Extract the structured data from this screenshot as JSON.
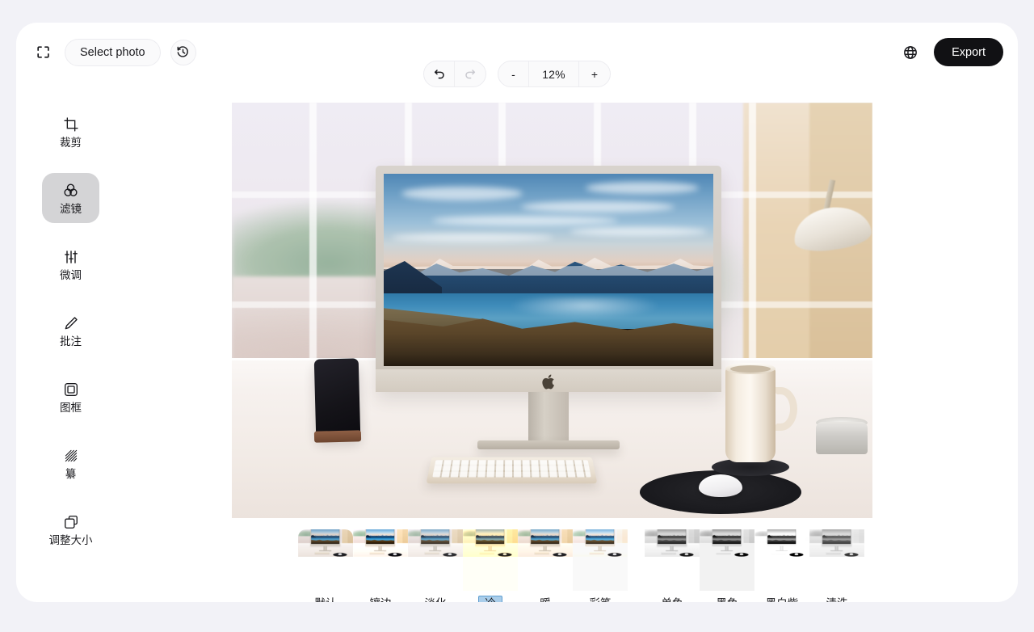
{
  "toolbar": {
    "fullscreen_icon": "fullscreen-icon",
    "select_photo_label": "Select photo",
    "history_icon": "history-icon",
    "undo_icon": "undo-icon",
    "redo_icon": "redo-icon",
    "zoom_out_label": "-",
    "zoom_value": "12%",
    "zoom_in_label": "+",
    "language_icon": "globe-icon",
    "export_label": "Export"
  },
  "sidebar": {
    "items": [
      {
        "label": "裁剪",
        "icon": "crop-icon",
        "active": false
      },
      {
        "label": "滤镜",
        "icon": "filter-icon",
        "active": true
      },
      {
        "label": "微调",
        "icon": "sliders-icon",
        "active": false
      },
      {
        "label": "批注",
        "icon": "pencil-icon",
        "active": false
      },
      {
        "label": "图框",
        "icon": "frame-icon",
        "active": false
      },
      {
        "label": "纂",
        "icon": "mosaic-icon",
        "active": false
      },
      {
        "label": "调整大小",
        "icon": "resize-icon",
        "active": false
      }
    ]
  },
  "filters": {
    "selected": "冷",
    "group_a": [
      {
        "label": "默认"
      },
      {
        "label": "镶边"
      },
      {
        "label": "淡化"
      },
      {
        "label": "冷"
      },
      {
        "label": "暖"
      },
      {
        "label": "彩笔"
      }
    ],
    "group_b": [
      {
        "label": "单色"
      },
      {
        "label": "黑色"
      },
      {
        "label": "黑白紫"
      },
      {
        "label": "渍洗"
      }
    ]
  },
  "canvas": {
    "photo_alt": "desk-with-imac-photo"
  },
  "colors": {
    "page_background": "#f2f2f7",
    "card_background": "#ffffff",
    "export_background": "#111114",
    "sidebar_active_background": "#d4d4d6",
    "filter_selected_background": "#a9cdea",
    "filter_selected_border": "#5e9ed0"
  }
}
